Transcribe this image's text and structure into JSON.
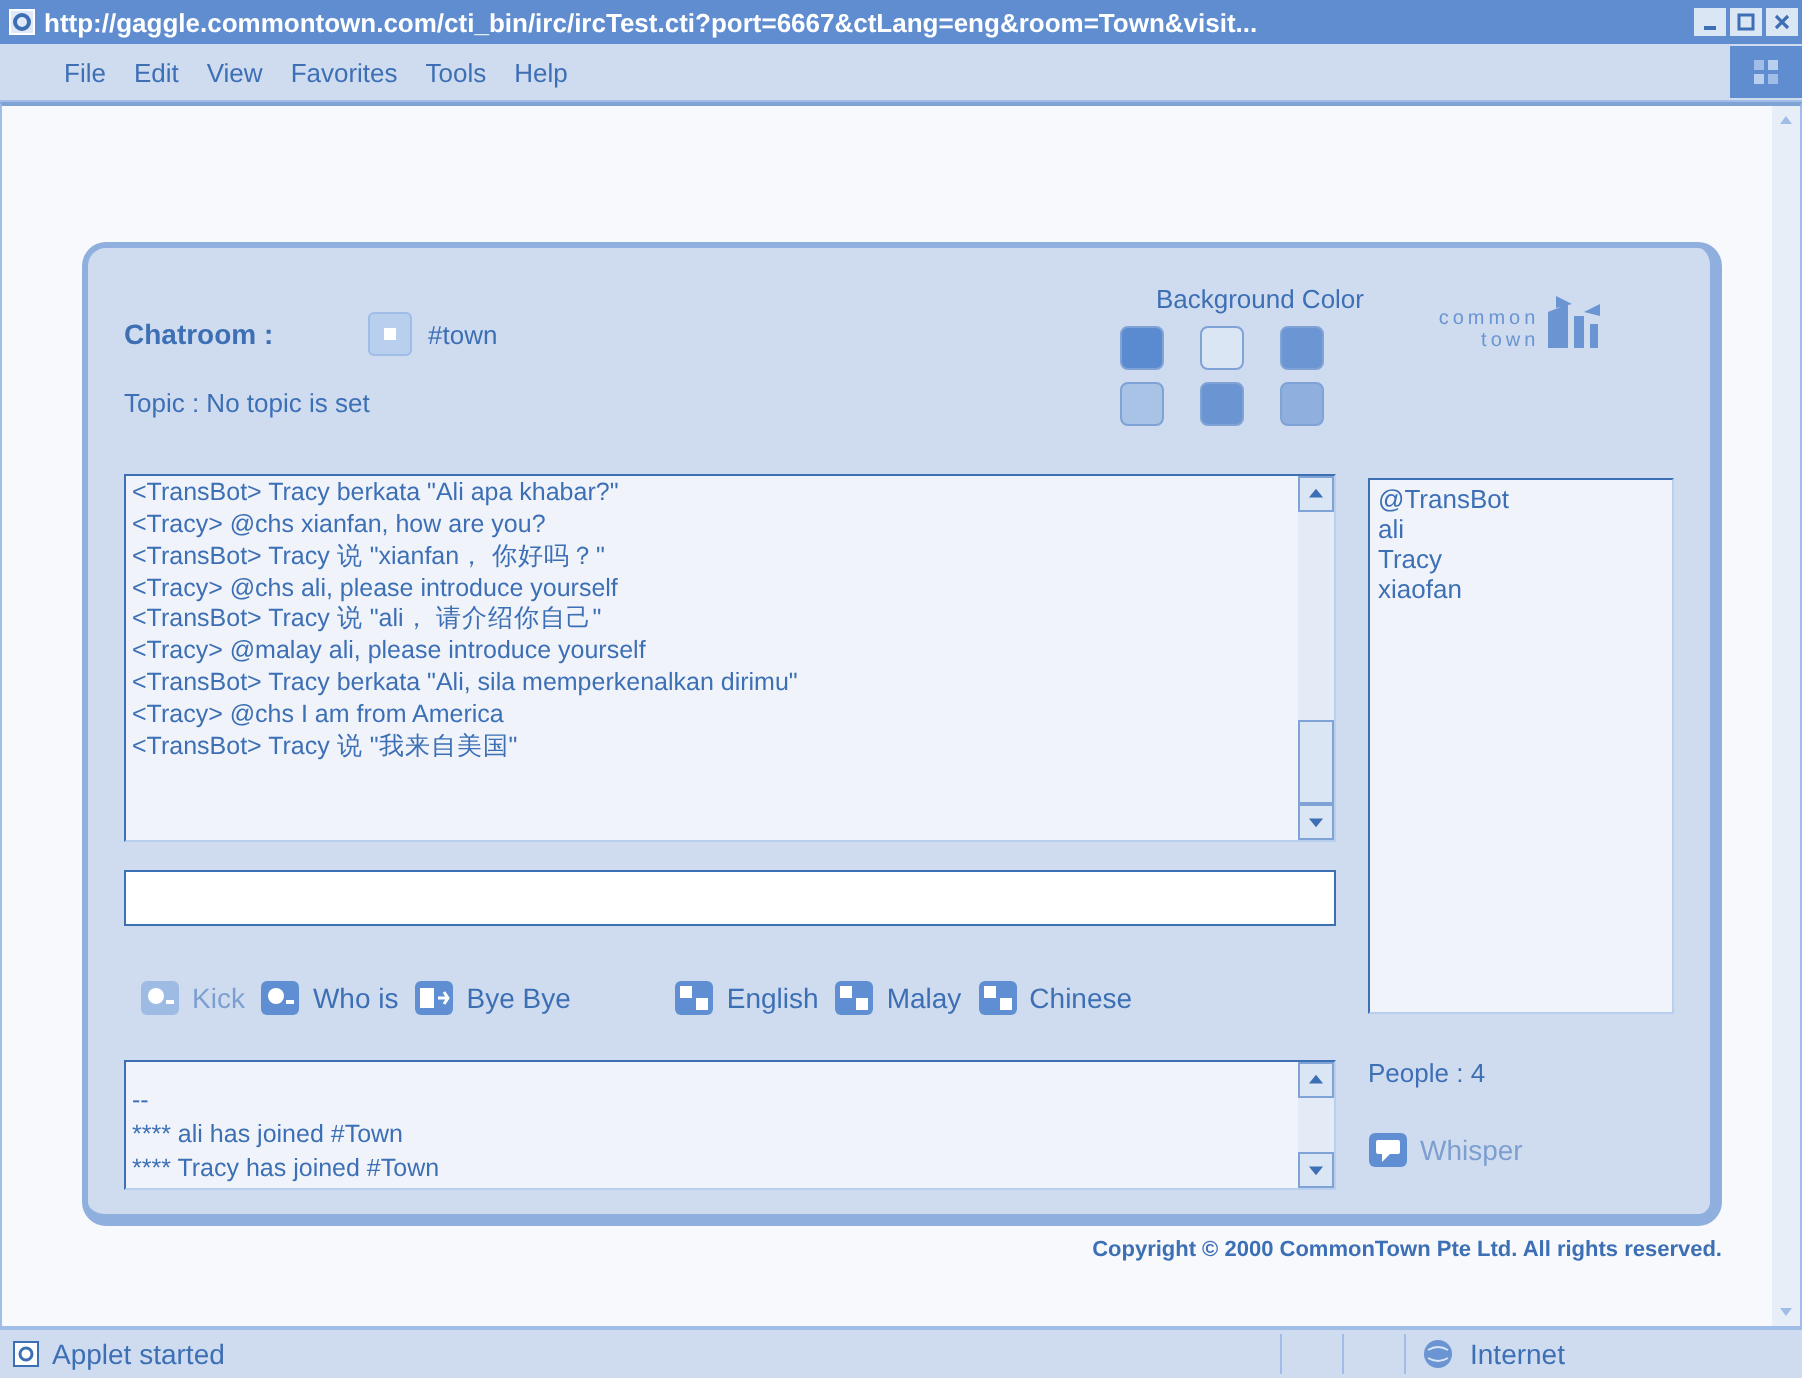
{
  "window": {
    "title": "http://gaggle.commontown.com/cti_bin/irc/ircTest.cti?port=6667&ctLang=eng&room=Town&visit..."
  },
  "menu": [
    "File",
    "Edit",
    "View",
    "Favorites",
    "Tools",
    "Help"
  ],
  "chatroom": {
    "label": "Chatroom :",
    "room": "#town",
    "topic": "Topic :  No topic is set"
  },
  "background_color": {
    "label": "Background Color",
    "swatches": [
      {
        "color": "#5a8ad0"
      },
      {
        "color": "#dbe6f4"
      },
      {
        "color": "#6b95d3"
      },
      {
        "color": "#a9c3e6"
      },
      {
        "color": "#6a94d2"
      },
      {
        "color": "#8fb0de"
      }
    ]
  },
  "logo": {
    "line1": "common",
    "line2": "town"
  },
  "messages": [
    "<TransBot> Tracy berkata \"Ali apa khabar?\"",
    "<Tracy> @chs xianfan, how are you?",
    "<TransBot> Tracy 说 \"xianfan，  你好吗？\"",
    "<Tracy> @chs ali, please introduce yourself",
    "<TransBot> Tracy 说 \"ali，  请介绍你自己\"",
    "<Tracy> @malay ali, please introduce yourself",
    "<TransBot> Tracy berkata \"Ali, sila memperkenalkan dirimu\"",
    "<Tracy> @chs I am from America",
    "<TransBot> Tracy 说 \"我来自美国\""
  ],
  "actions": [
    {
      "label": "Kick",
      "kind": "kick",
      "disabled": true
    },
    {
      "label": "Who is",
      "kind": "whois",
      "disabled": false
    },
    {
      "label": "Bye Bye",
      "kind": "bye",
      "disabled": false
    },
    {
      "label": "English",
      "kind": "english",
      "disabled": false
    },
    {
      "label": "Malay",
      "kind": "malay",
      "disabled": false
    },
    {
      "label": "Chinese",
      "kind": "chinese",
      "disabled": false
    }
  ],
  "system_log": [
    "--",
    "**** ali has joined #Town",
    "**** Tracy has joined #Town"
  ],
  "users": [
    "@TransBot",
    "ali",
    "Tracy",
    "xiaofan"
  ],
  "people": "People : 4",
  "whisper": {
    "label": "Whisper",
    "disabled": true
  },
  "copyright": "Copyright © 2000 CommonTown Pte Ltd. All rights reserved.",
  "status_bar": {
    "text": "Applet started",
    "zone": "Internet"
  }
}
